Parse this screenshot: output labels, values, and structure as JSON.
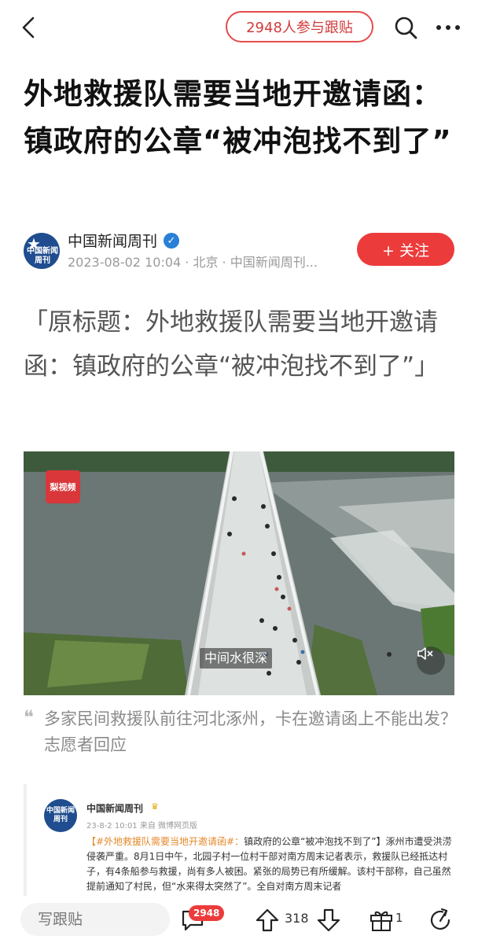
{
  "header": {
    "participants_label": "2948人参与跟贴"
  },
  "article": {
    "headline": "外地救援队需要当地开邀请函：镇政府的公章“被冲泡找不到了”",
    "author": {
      "name": "中国新闻周刊",
      "avatar_text": "中国新闻周刊",
      "meta": "2023-08-02 10:04 · 北京 · 中国新闻周刊...",
      "follow_label": "+ 关注"
    },
    "original_title": "「原标题：外地救援队需要当地开邀请函：镇政府的公章“被冲泡找不到了”」",
    "video": {
      "logo_text": "梨视频",
      "caption": "中间水很深",
      "mute_icon": "mute-icon"
    },
    "quote": "多家民间救援队前往河北涿州，卡在邀请函上不能出发？志愿者回应",
    "embed": {
      "avatar_text": "中国新闻周刊",
      "name": "中国新闻周刊",
      "meta": "23-8-2 10:01  来自 微博网页版",
      "tag": "【#外地救援队需要当地开邀请函#：",
      "body": "镇政府的公章“被冲泡找不到了”】涿州市遭受洪涝侵袭严重。8月1日中午，北园子村一位村干部对南方周末记者表示，救援队已经抵达村子，有4条船参与救援，尚有多人被困。紧张的局势已有所缓解。该村干部称，自己虽然提前通知了村民，但“水来得太突然了”。全自对南方周末记者"
    }
  },
  "bottom_bar": {
    "write_placeholder": "写跟贴",
    "comment_count": "2948",
    "vote_count": "318",
    "gift_count": "1"
  },
  "colors": {
    "accent": "#ec3b3b",
    "verified": "#2a7fd6",
    "brand_blue": "#1f4d8f"
  }
}
